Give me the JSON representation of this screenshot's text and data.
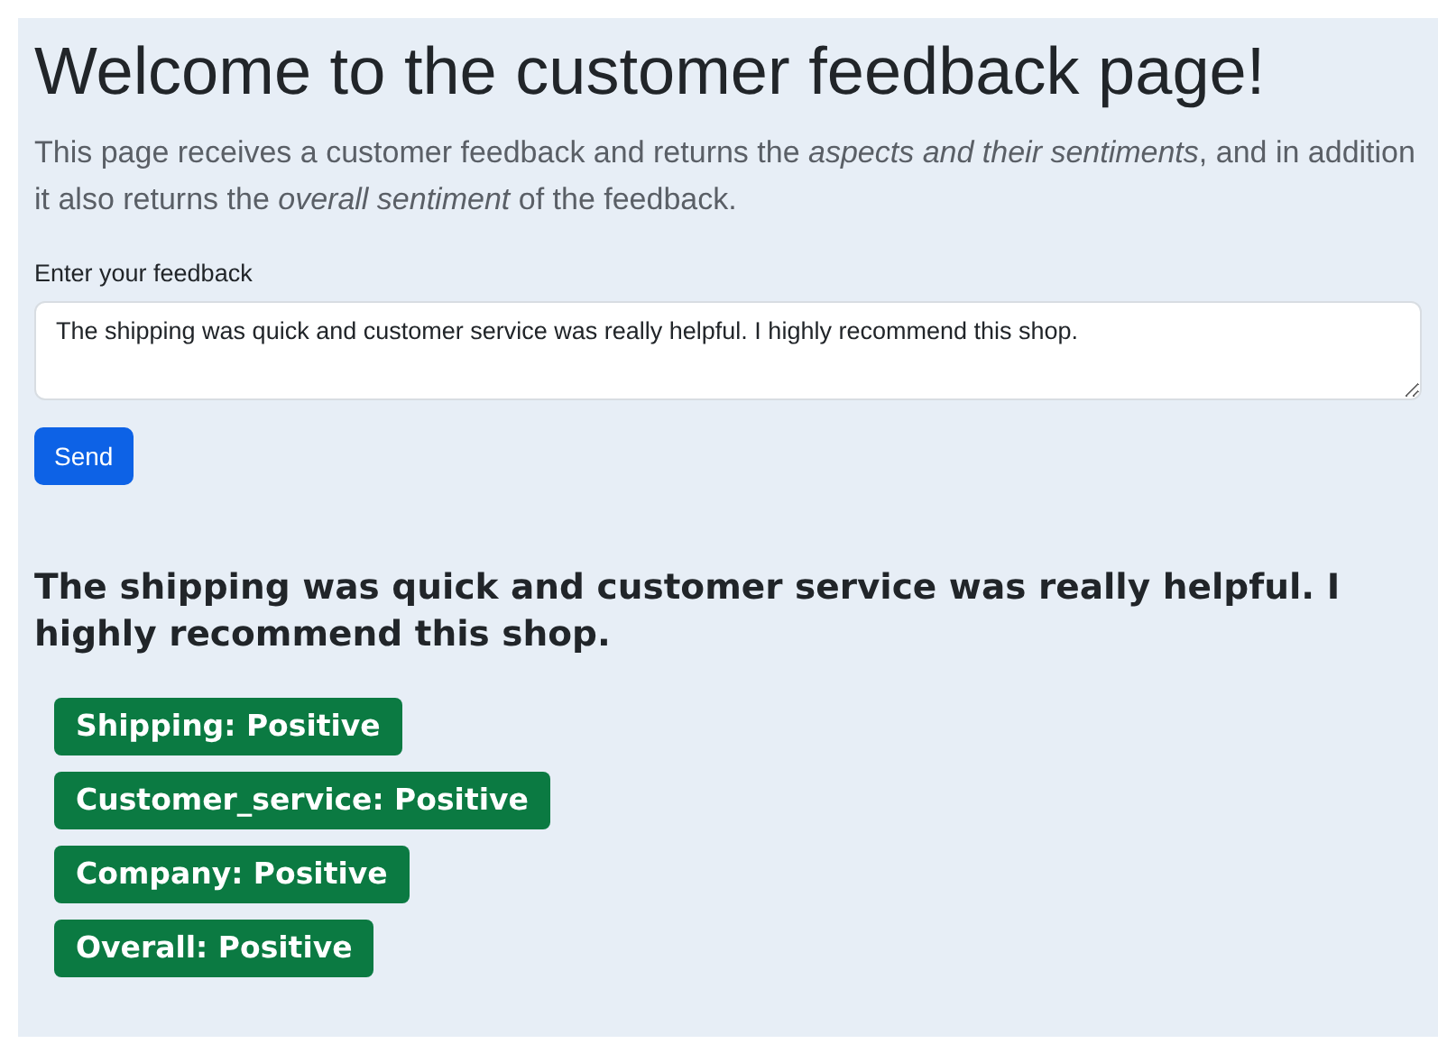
{
  "title": "Welcome to the customer feedback page!",
  "intro": "This page receives a customer feedback and returns the *aspects and their sentiments*, and in addition it also returns the *overall sentiment* of the feedback.",
  "feedback_field": {
    "label": "Enter your feedback",
    "value": "The shipping was quick and customer service was really helpful. I highly recommend this shop."
  },
  "send_button": "Send",
  "result_heading": "The shipping was quick and customer service was really helpful. I highly recommend this shop.",
  "badges": [
    {
      "label": "Shipping: Positive",
      "color": "#0b7a42"
    },
    {
      "label": "Customer_service: Positive",
      "color": "#0b7a42"
    },
    {
      "label": "Company: Positive",
      "color": "#0b7a42"
    },
    {
      "label": "Overall: Positive",
      "color": "#0b7a42"
    }
  ]
}
